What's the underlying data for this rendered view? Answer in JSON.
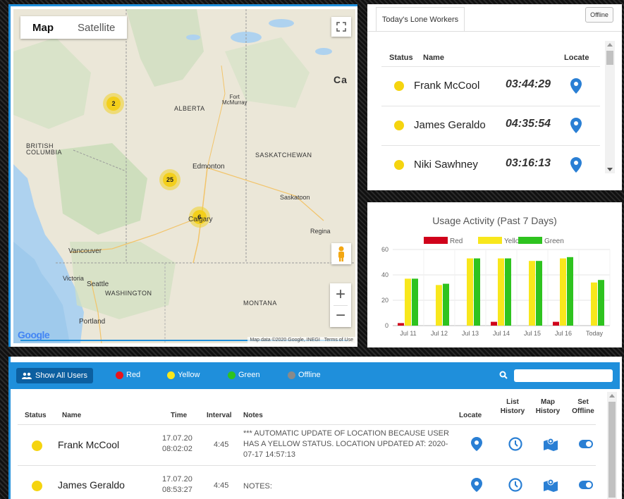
{
  "map": {
    "toggle": {
      "map": "Map",
      "satellite": "Satellite"
    },
    "zoom_in": "+",
    "zoom_out": "−",
    "clusters": [
      {
        "count": "2"
      },
      {
        "count": "25"
      },
      {
        "count": "6"
      }
    ],
    "regions": {
      "alberta": "ALBERTA",
      "british_columbia": "BRITISH\nCOLUMBIA",
      "saskatchewan": "SASKATCHEWAN",
      "washington": "WASHINGTON",
      "montana": "MONTANA",
      "canada": "Ca"
    },
    "cities": {
      "fort_mcmurray": "Fort\nMcMurray",
      "edmonton": "Edmonton",
      "saskatoon": "Saskatoon",
      "calgary": "Calgary",
      "regina": "Regina",
      "vancouver": "Vancouver",
      "victoria": "Victoria",
      "seattle": "Seattle",
      "portland": "Portland"
    },
    "logo": "Google",
    "attribution": "Map data ©2020 Google, INEGI",
    "terms": "Terms of Use"
  },
  "lone_workers": {
    "tab": "Today's Lone Workers",
    "offline_button": "Offline",
    "columns": {
      "status": "Status",
      "name": "Name",
      "locate": "Locate"
    },
    "rows": [
      {
        "name": "Frank McCool",
        "time": "03:44:29",
        "status_color": "#f5d40f"
      },
      {
        "name": "James Geraldo",
        "time": "04:35:54",
        "status_color": "#f5d40f"
      },
      {
        "name": "Niki Sawhney",
        "time": "03:16:13",
        "status_color": "#f5d40f"
      }
    ]
  },
  "chart_data": {
    "type": "bar",
    "title": "Usage Activity (Past 7 Days)",
    "categories": [
      "Jul 11",
      "Jul 12",
      "Jul 13",
      "Jul 14",
      "Jul 15",
      "Jul 16",
      "Today"
    ],
    "series": [
      {
        "name": "Red",
        "color": "#d0021b",
        "values": [
          2,
          0,
          0,
          3,
          0,
          3,
          0
        ]
      },
      {
        "name": "Yellow",
        "color": "#f8e71c",
        "values": [
          37,
          32,
          53,
          53,
          51,
          53,
          34
        ]
      },
      {
        "name": "Green",
        "color": "#2ec31f",
        "values": [
          37,
          33,
          53,
          53,
          51,
          54,
          36
        ]
      }
    ],
    "ylim": [
      0,
      60
    ],
    "yticks": [
      0,
      20,
      40,
      60
    ],
    "grid": true,
    "legend": "top"
  },
  "users_table": {
    "show_all": "Show All Users",
    "legend": [
      {
        "label": "Red",
        "color": "#e8141b"
      },
      {
        "label": "Yellow",
        "color": "#f8e71c"
      },
      {
        "label": "Green",
        "color": "#2ec31f"
      },
      {
        "label": "Offline",
        "color": "#8a8a8a"
      }
    ],
    "search_placeholder": "",
    "columns": {
      "status": "Status",
      "name": "Name",
      "time": "Time",
      "interval": "Interval",
      "notes": "Notes",
      "locate": "Locate",
      "list_history": "List\nHistory",
      "map_history": "Map\nHistory",
      "set_offline": "Set\nOffline"
    },
    "rows": [
      {
        "name": "Frank McCool",
        "date": "17.07.20",
        "clock": "08:02:02",
        "interval": "4:45",
        "notes": "*** AUTOMATIC UPDATE OF LOCATION BECAUSE USER HAS A YELLOW STATUS. LOCATION UPDATED AT: 2020-07-17 14:57:13"
      },
      {
        "name": "James Geraldo",
        "date": "17.07.20",
        "clock": "08:53:27",
        "interval": "4:45",
        "notes": "NOTES:"
      }
    ]
  },
  "colors": {
    "accent": "#1f8fdb",
    "icon_blue": "#2a7fd4",
    "status_yellow": "#f5d40f"
  }
}
